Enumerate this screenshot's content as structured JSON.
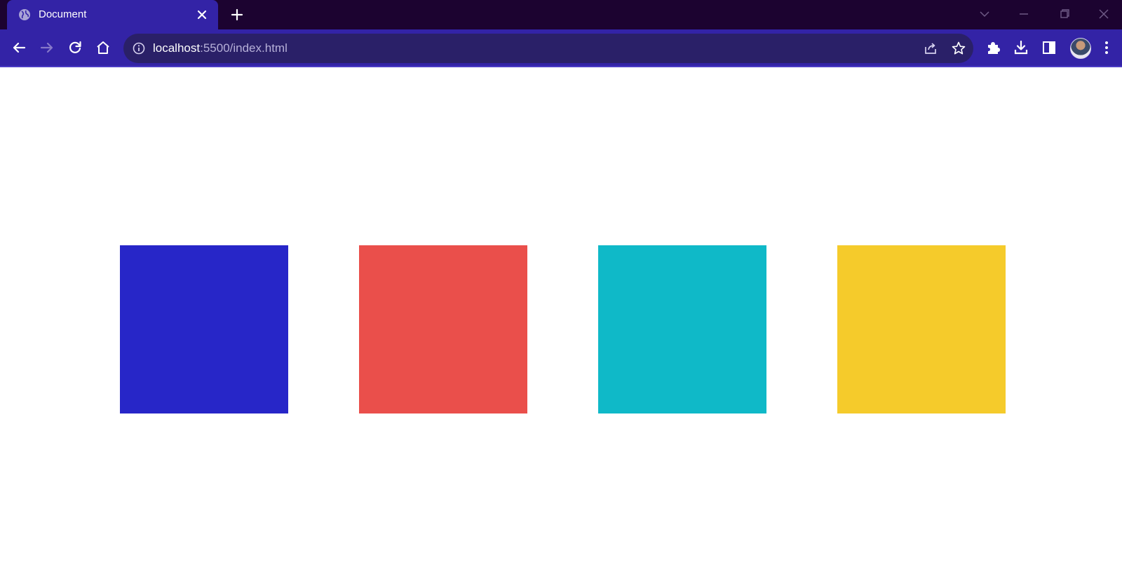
{
  "tab": {
    "title": "Document",
    "favicon": "globe-icon"
  },
  "address_bar": {
    "host": "localhost",
    "rest": ":5500/index.html"
  },
  "boxes": [
    {
      "color": "#2726c8"
    },
    {
      "color": "#ea4f4b"
    },
    {
      "color": "#0fb9c8"
    },
    {
      "color": "#f5cb2b"
    }
  ],
  "colors": {
    "tabstrip": "#1c0330",
    "toolbar": "#3323a6",
    "omnibox": "#2a2068"
  }
}
